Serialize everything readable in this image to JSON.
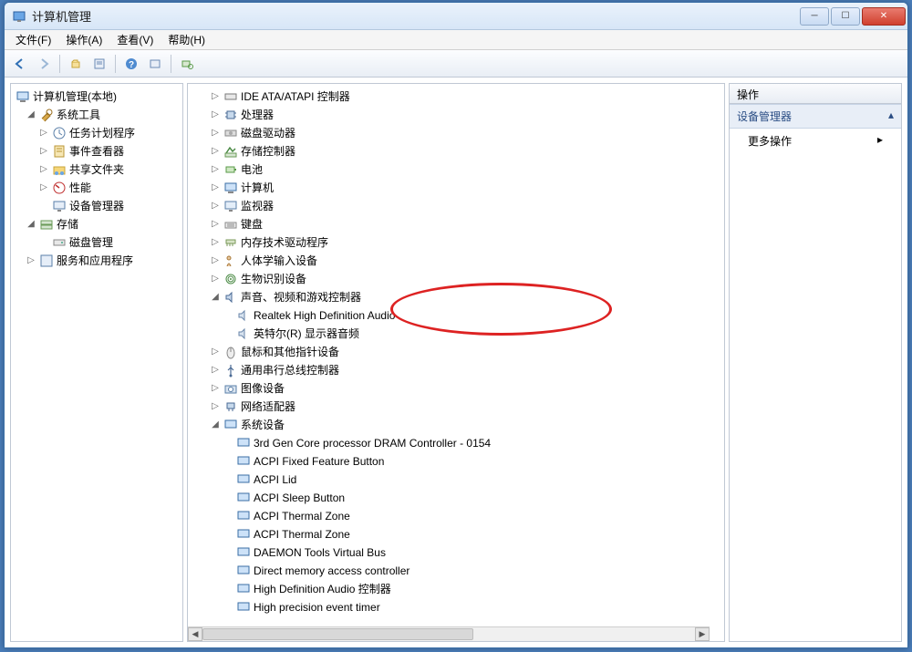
{
  "window": {
    "title": "计算机管理"
  },
  "menu": {
    "file": "文件(F)",
    "action": "操作(A)",
    "view": "查看(V)",
    "help": "帮助(H)"
  },
  "left_tree": {
    "root": "计算机管理(本地)",
    "system_tools": "系统工具",
    "task_scheduler": "任务计划程序",
    "event_viewer": "事件查看器",
    "shared_folders": "共享文件夹",
    "performance": "性能",
    "device_manager": "设备管理器",
    "storage": "存储",
    "disk_management": "磁盘管理",
    "services_apps": "服务和应用程序"
  },
  "mid_tree": {
    "ide": "IDE ATA/ATAPI 控制器",
    "cpu": "处理器",
    "disk_drives": "磁盘驱动器",
    "storage_ctrl": "存储控制器",
    "battery": "电池",
    "computer": "计算机",
    "monitor": "监视器",
    "keyboard": "键盘",
    "memtech": "内存技术驱动程序",
    "hid": "人体学输入设备",
    "biometric": "生物识别设备",
    "sound": "声音、视频和游戏控制器",
    "sound_realtek": "Realtek High Definition Audio",
    "sound_intel": "英特尔(R) 显示器音频",
    "mouse": "鼠标和其他指针设备",
    "usb": "通用串行总线控制器",
    "imaging": "图像设备",
    "network": "网络适配器",
    "system_devices": "系统设备",
    "sd_dram": "3rd Gen Core processor DRAM Controller - 0154",
    "sd_fixed": "ACPI Fixed Feature Button",
    "sd_lid": "ACPI Lid",
    "sd_sleep": "ACPI Sleep Button",
    "sd_tz1": "ACPI Thermal Zone",
    "sd_tz2": "ACPI Thermal Zone",
    "sd_daemon": "DAEMON Tools Virtual Bus",
    "sd_dma": "Direct memory access controller",
    "sd_hdaudio": "High Definition Audio 控制器",
    "sd_hpet": "High precision event timer"
  },
  "right": {
    "header": "操作",
    "section": "设备管理器",
    "more": "更多操作"
  }
}
